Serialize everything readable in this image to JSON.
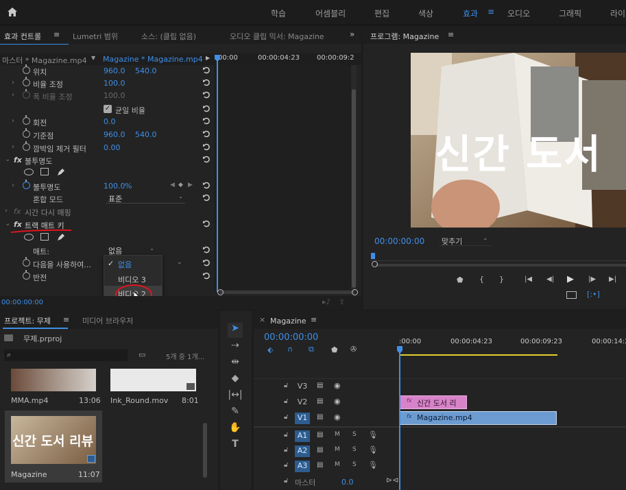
{
  "workspace": {
    "tabs": [
      "학습",
      "어셈블리",
      "편집",
      "색상",
      "효과",
      "오디오",
      "그래픽",
      "라이"
    ],
    "active": "효과"
  },
  "effect_controls": {
    "tabs": [
      "효과 컨트롤",
      "Lumetri 범위",
      "소스: (클립 없음)",
      "오디오 클립 믹서: Magazine"
    ],
    "master_label": "마스터 * Magazine.mp4",
    "clip_label": "Magazine * Magazine.mp4",
    "ruler": [
      "00:00",
      "00:00:04:23",
      "00:00:09:2"
    ],
    "rows": {
      "position": {
        "label": "위치",
        "v1": "960.0",
        "v2": "540.0"
      },
      "scale": {
        "label": "비율 조정",
        "v1": "100.0"
      },
      "scale_width": {
        "label": "폭 비율 조정",
        "v1": "100.0"
      },
      "uniform_scale": {
        "label": "균일 비율"
      },
      "rotation": {
        "label": "회전",
        "v1": "0.0"
      },
      "anchor": {
        "label": "기준점",
        "v1": "960.0",
        "v2": "540.0"
      },
      "anti_flicker": {
        "label": "깜박임 제거 필터",
        "v1": "0.00"
      },
      "opacity_section": {
        "label": "불투명도"
      },
      "opacity": {
        "label": "불투명도",
        "v1": "100.0",
        "unit": "%"
      },
      "blend": {
        "label": "혼합 모드",
        "value": "표준"
      },
      "time_remap": {
        "label": "시간 다시 매핑"
      },
      "track_matte": {
        "label": "트랙 매트 키"
      },
      "matte": {
        "label": "매트:",
        "value": "없음"
      },
      "composite": {
        "label": "다음을 사용하여..."
      },
      "invert": {
        "label": "반전"
      }
    },
    "matte_menu": [
      "없음",
      "비디오 3",
      "비디오 2"
    ],
    "timecode": "00:00:00:00"
  },
  "program": {
    "title": "프로그램: Magazine",
    "overlay_text": "신간 도서",
    "timecode": "00:00:00:00",
    "fit": "맞추기"
  },
  "project": {
    "tabs": [
      "프로젝트: 무제",
      "미디어 브라우저"
    ],
    "file": "무제.prproj",
    "count": "5개 중 1개...",
    "items": [
      {
        "name": "MMA.mp4",
        "duration": "13:06"
      },
      {
        "name": "Ink_Round.mov",
        "duration": "8:01"
      },
      {
        "name": "Magazine",
        "duration": "11:07",
        "thumb_text": "신간 도서 리뷰"
      }
    ]
  },
  "timeline": {
    "title": "Magazine",
    "timecode": "00:00:00:00",
    "ruler": [
      ":00:00",
      "00:00:04:23",
      "00:00:09:23",
      "00:00:14:2"
    ],
    "video_tracks": [
      "V3",
      "V2",
      "V1"
    ],
    "audio_tracks": [
      "A1",
      "A2",
      "A3"
    ],
    "audio_buttons": {
      "mute": "M",
      "solo": "S"
    },
    "master": {
      "label": "마스터",
      "value": "0.0"
    },
    "clips": [
      {
        "track": "V2",
        "name": "신간 도서 리",
        "color": "#d883c9"
      },
      {
        "track": "V1",
        "name": "Magazine.mp4",
        "color": "#6b9bd1"
      }
    ]
  },
  "colors": {
    "accent": "#3f8fe8",
    "playhead": "#3f8fe8",
    "annotation": "#e0141e"
  }
}
